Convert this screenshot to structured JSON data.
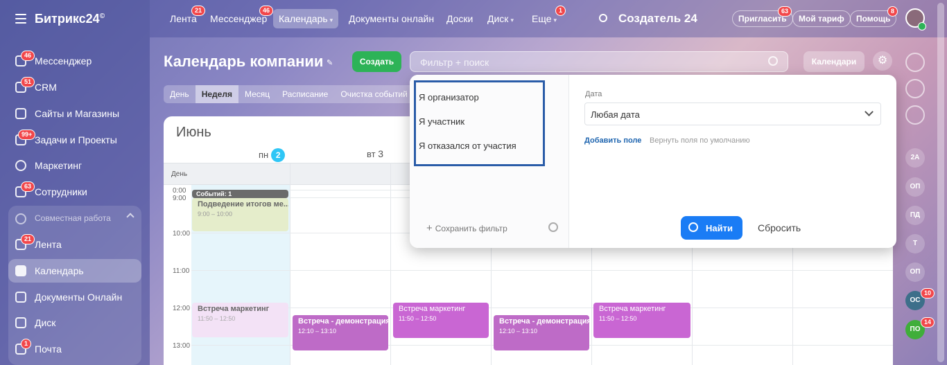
{
  "app": {
    "logo": "Битрикс24",
    "logo_mark": "©"
  },
  "sidebar": {
    "items": [
      {
        "label": "Мессенджер",
        "badge": "46"
      },
      {
        "label": "CRM",
        "badge": "51"
      },
      {
        "label": "Сайты и Магазины",
        "badge": ""
      },
      {
        "label": "Задачи и Проекты",
        "badge": "99+"
      },
      {
        "label": "Маркетинг",
        "badge": ""
      },
      {
        "label": "Сотрудники",
        "badge": "63"
      },
      {
        "label": "Совместная работа",
        "badge": ""
      },
      {
        "label": "Лента",
        "badge": "21"
      },
      {
        "label": "Календарь",
        "badge": ""
      },
      {
        "label": "Документы Онлайн",
        "badge": ""
      },
      {
        "label": "Диск",
        "badge": ""
      },
      {
        "label": "Почта",
        "badge": "1"
      }
    ]
  },
  "topnav": {
    "items": [
      {
        "label": "Лента",
        "badge": "21"
      },
      {
        "label": "Мессенджер",
        "badge": "46"
      },
      {
        "label": "Календарь",
        "badge": ""
      },
      {
        "label": "Документы онлайн",
        "badge": ""
      },
      {
        "label": "Доски",
        "badge": ""
      },
      {
        "label": "Диск",
        "badge": ""
      },
      {
        "label": "Еще",
        "badge": "1"
      }
    ],
    "user": "Создатель 24",
    "invite": "Пригласить",
    "invite_badge": "63",
    "tariff": "Мой тариф",
    "help": "Помощь",
    "help_badge": "8"
  },
  "header": {
    "title": "Календарь компании",
    "create": "Создать",
    "search_placeholder": "Фильтр + поиск",
    "calendars": "Календари"
  },
  "tabs": [
    "День",
    "Неделя",
    "Месяц",
    "Расписание",
    "Очистка событий в к"
  ],
  "calendar": {
    "month": "Июнь",
    "days": [
      {
        "name": "пн",
        "num": "2"
      },
      {
        "name": "вт",
        "num": "3"
      }
    ],
    "allday_label": "День",
    "times": [
      "0:00",
      "9:00",
      "10:00",
      "11:00",
      "12:00",
      "13:00"
    ],
    "events": [
      {
        "title": "Событий: 1",
        "time": ""
      },
      {
        "title": "Подведение итогов ме...",
        "time": "9:00 – 10:00"
      },
      {
        "title": "Встреча маркетинг",
        "time": "11:50 – 12:50"
      },
      {
        "title": "Встреча - демонстрация",
        "time": "12:10 – 13:10"
      },
      {
        "title": "Встреча маркетинг",
        "time": "11:50 – 12:50"
      },
      {
        "title": "Встреча - демонстрация",
        "time": "12:10 – 13:10"
      },
      {
        "title": "Встреча маркетинг",
        "time": "11:50 – 12:50"
      }
    ]
  },
  "filter": {
    "presets": [
      "Я организатор",
      "Я участник",
      "Я отказался от участия"
    ],
    "save_filter": "Сохранить фильтр",
    "field_label": "Дата",
    "date_value": "Любая дата",
    "add_field": "Добавить поле",
    "reset_fields": "Вернуть поля по умолчанию",
    "find": "Найти",
    "reset": "Сбросить"
  },
  "rail": {
    "avatars": [
      "2А",
      "ОП",
      "ПД",
      "Т",
      "ОП",
      "ОС",
      "ПО"
    ],
    "badges": {
      "os": "10",
      "po": "14"
    }
  }
}
